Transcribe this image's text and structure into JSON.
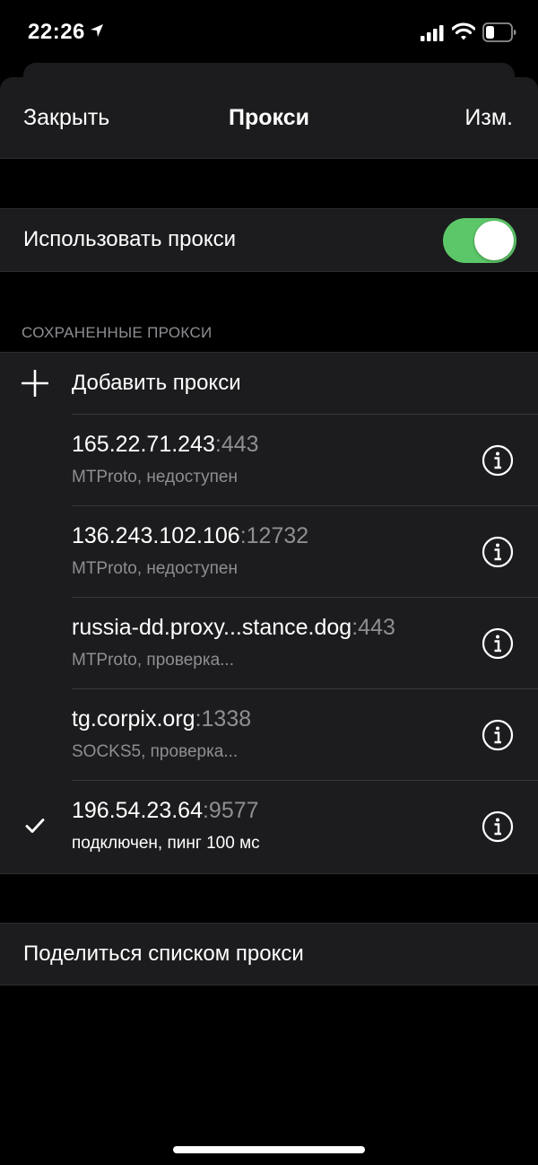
{
  "status_bar": {
    "time": "22:26",
    "icons": [
      "location-arrow-icon",
      "signal-icon",
      "wifi-icon",
      "battery-icon"
    ]
  },
  "nav": {
    "close_label": "Закрыть",
    "title": "Прокси",
    "edit_label": "Изм."
  },
  "use_proxy": {
    "label": "Использовать прокси",
    "enabled": true
  },
  "saved_proxies": {
    "header": "СОХРАНЕННЫЕ ПРОКСИ",
    "add_label": "Добавить прокси",
    "items": [
      {
        "host": "165.22.71.243",
        "port": ":443",
        "status": "MTProto, недоступен",
        "selected": false
      },
      {
        "host": "136.243.102.106",
        "port": ":12732",
        "status": "MTProto, недоступен",
        "selected": false
      },
      {
        "host": "russia-dd.proxy...stance.dog",
        "port": ":443",
        "status": "MTProto, проверка...",
        "selected": false
      },
      {
        "host": "tg.corpix.org",
        "port": ":1338",
        "status": "SOCKS5, проверка...",
        "selected": false
      },
      {
        "host": "196.54.23.64",
        "port": ":9577",
        "status": "подключен, пинг 100 мс",
        "selected": true
      }
    ]
  },
  "share": {
    "label": "Поделиться списком прокси"
  },
  "colors": {
    "background": "#000000",
    "cell": "#1c1c1e",
    "switch_on": "#5cc768",
    "secondary_text": "#8e8e93"
  }
}
